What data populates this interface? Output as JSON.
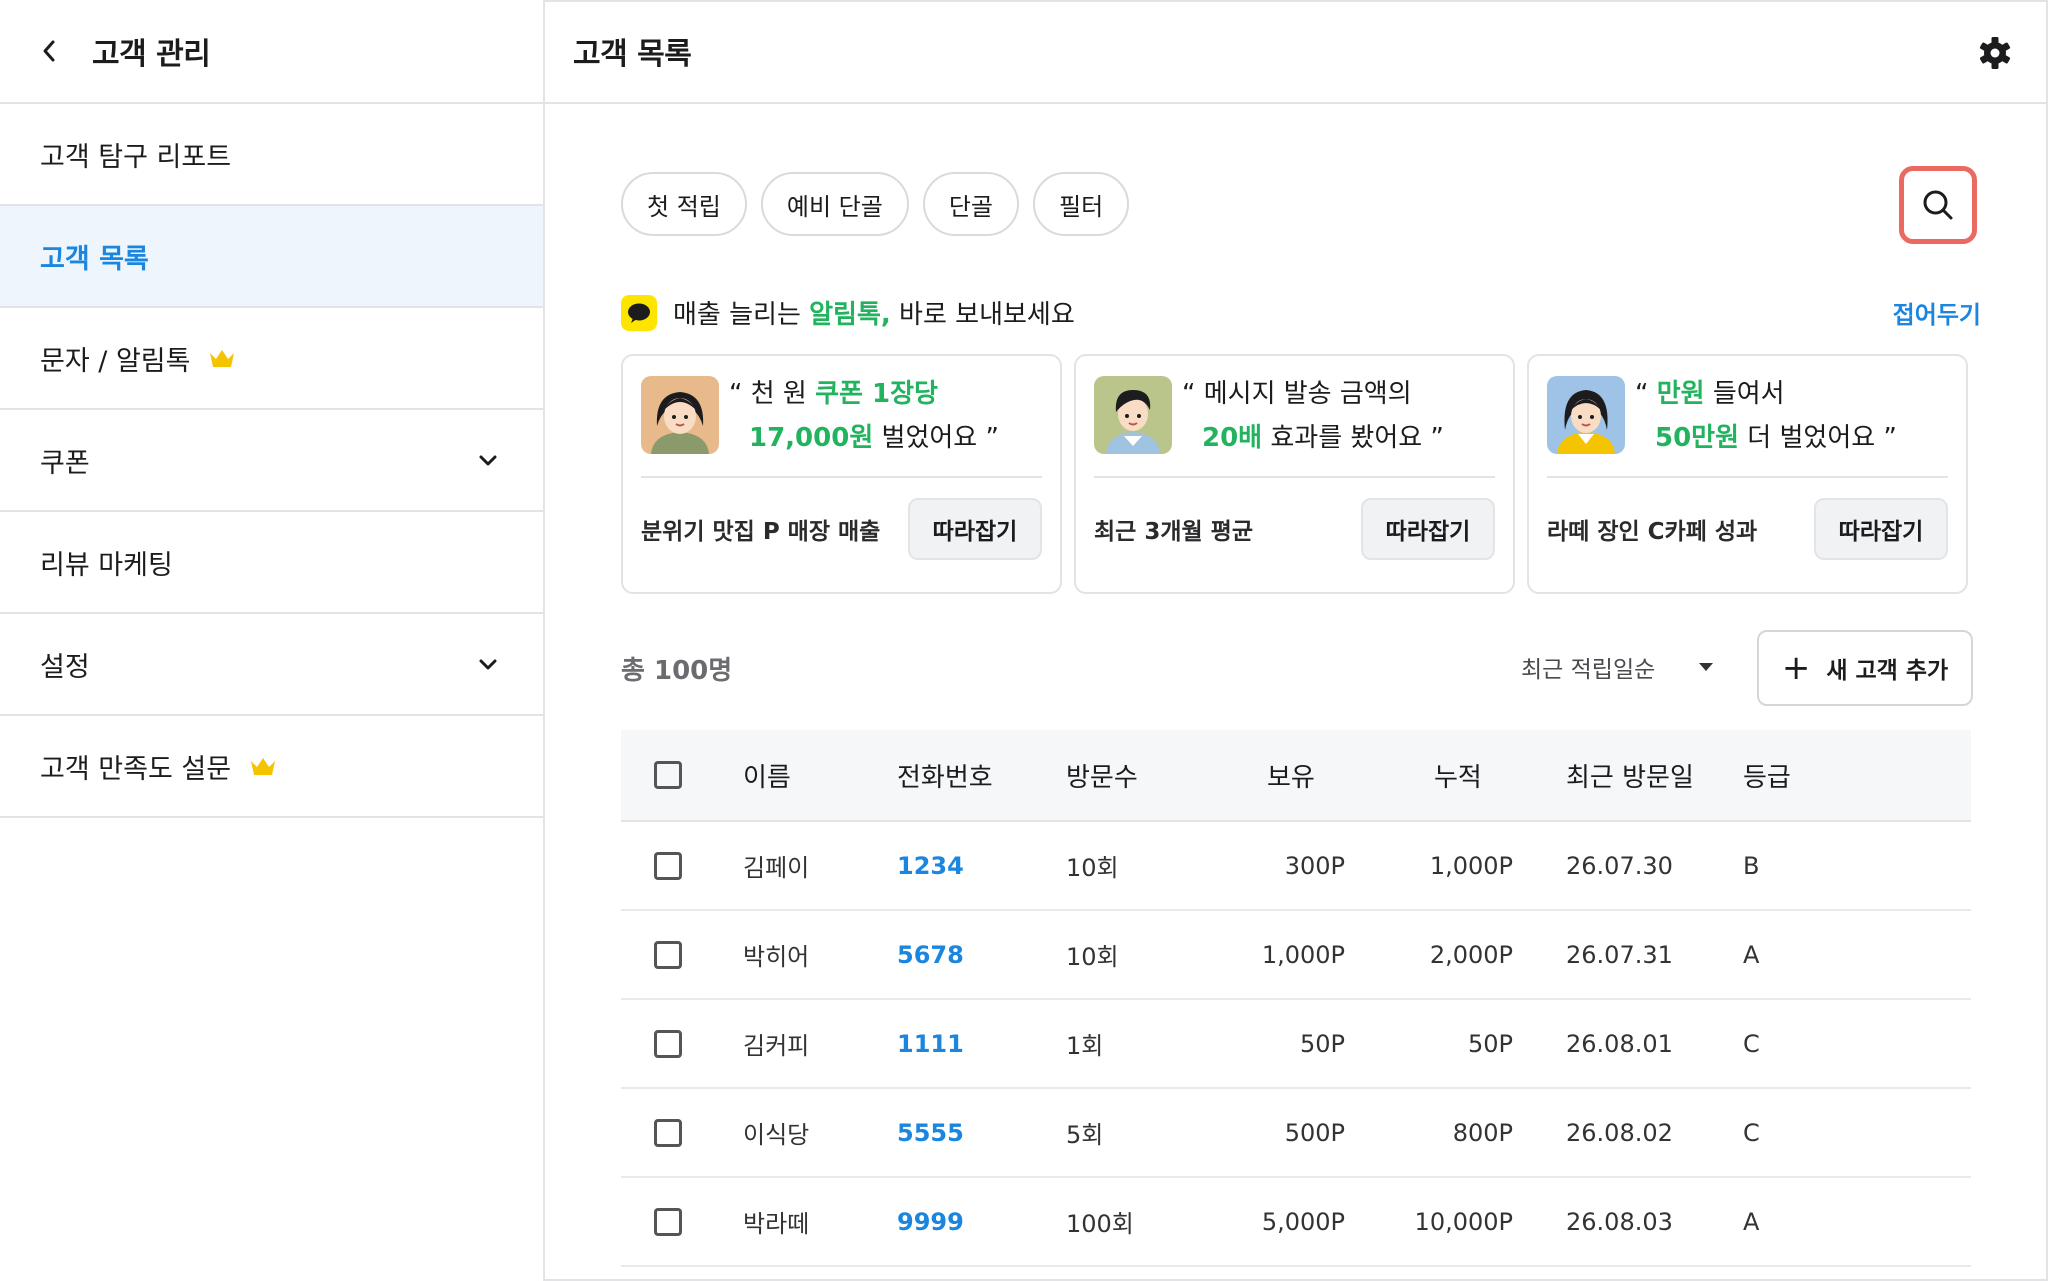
{
  "sidebar": {
    "title": "고객 관리",
    "items": [
      {
        "label": "고객 탐구 리포트"
      },
      {
        "label": "고객 목록"
      },
      {
        "label": "문자 / 알림톡"
      },
      {
        "label": "쿠폰"
      },
      {
        "label": "리뷰 마케팅"
      },
      {
        "label": "설정"
      },
      {
        "label": "고객 만족도 설문"
      }
    ]
  },
  "header": {
    "title": "고객 목록"
  },
  "chips": [
    "첫 적립",
    "예비 단골",
    "단골",
    "필터"
  ],
  "promo": {
    "prefix": "매출 늘리는 ",
    "highlight": "알림톡,",
    "suffix": " 바로 보내보세요",
    "collapse": "접어두기"
  },
  "cards": [
    {
      "q1a": "“ 천 원 ",
      "q1b": "쿠폰 1장당",
      "q1c": "",
      "q2a": "17,000원",
      "q2b": " 벌었어요 ”",
      "caption": "분위기 맛집 P 매장 매출",
      "button": "따라잡기"
    },
    {
      "q1a": "“ 메시지 발송 금액의",
      "q1b": "",
      "q1c": "",
      "q2a": "20배",
      "q2b": " 효과를 봤어요  ”",
      "caption": "최근 3개월 평균",
      "button": "따라잡기"
    },
    {
      "q1a": "“ ",
      "q1b": "만원",
      "q1c": " 들여서",
      "q2a": "50만원",
      "q2b": " 더 벌었어요 ”",
      "caption": "라떼 장인 C카페 성과",
      "button": "따라잡기"
    }
  ],
  "list": {
    "total": "총 100명",
    "sort": "최근 적립일순",
    "add_button": "새 고객 추가"
  },
  "table": {
    "headers": {
      "name": "이름",
      "phone": "전화번호",
      "visits": "방문수",
      "hold": "보유",
      "acc": "누적",
      "date": "최근 방문일",
      "grade": "등급"
    },
    "rows": [
      {
        "name": "김페이",
        "phone": "1234",
        "visits": "10회",
        "hold": "300P",
        "acc": "1,000P",
        "date": "26.07.30",
        "grade": "B"
      },
      {
        "name": "박히어",
        "phone": "5678",
        "visits": "10회",
        "hold": "1,000P",
        "acc": "2,000P",
        "date": "26.07.31",
        "grade": "A"
      },
      {
        "name": "김커피",
        "phone": "1111",
        "visits": "1회",
        "hold": "50P",
        "acc": "50P",
        "date": "26.08.01",
        "grade": "C"
      },
      {
        "name": "이식당",
        "phone": "5555",
        "visits": "5회",
        "hold": "500P",
        "acc": "800P",
        "date": "26.08.02",
        "grade": "C"
      },
      {
        "name": "박라떼",
        "phone": "9999",
        "visits": "100회",
        "hold": "5,000P",
        "acc": "10,000P",
        "date": "26.08.03",
        "grade": "A"
      }
    ]
  },
  "colors": {
    "accent": "#1a86e0",
    "green": "#22b35f",
    "search_highlight": "#ea6a62",
    "kakao": "#fee500",
    "crown": "#f5c400"
  },
  "icons": [
    "chevron-left-icon",
    "crown-icon",
    "chevron-down-icon",
    "gear-icon",
    "search-icon",
    "kakao-chat-icon",
    "plus-icon"
  ]
}
